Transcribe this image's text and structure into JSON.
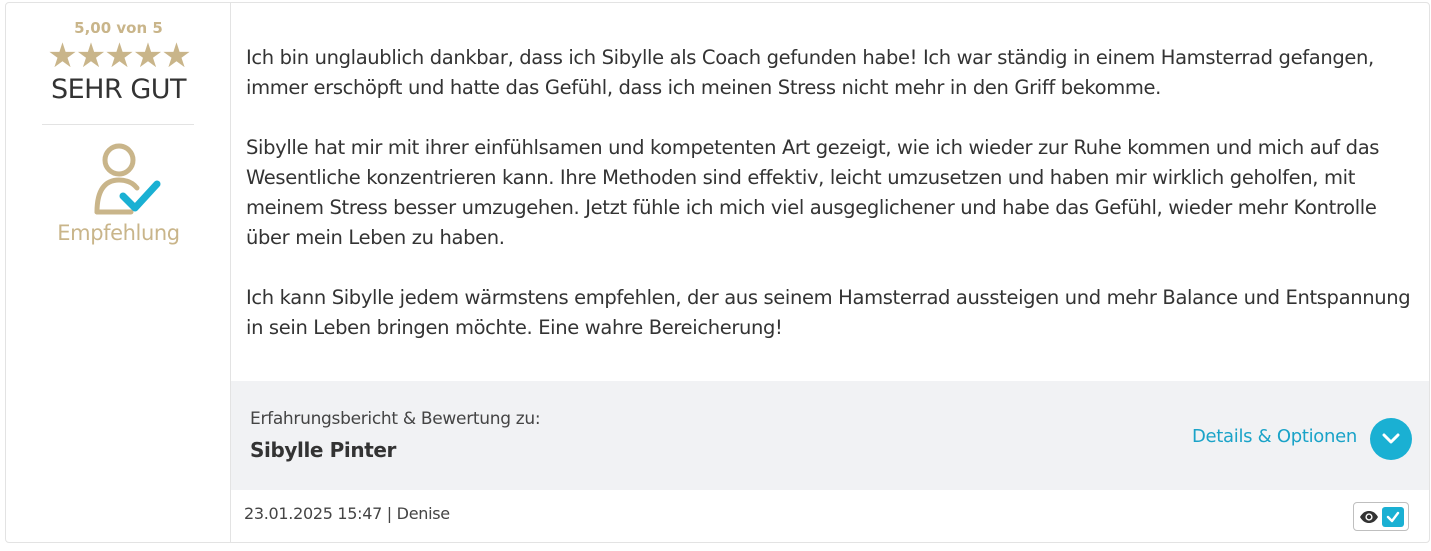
{
  "rating": {
    "score_text": "5,00 von 5",
    "stars": "★★★★★",
    "stars_count": 5,
    "label": "SEHR GUT",
    "color": "#c9b58a"
  },
  "recommendation": {
    "icon": "user-check-icon",
    "label": "Empfehlung"
  },
  "review": {
    "paragraphs": [
      "Ich bin unglaublich dankbar, dass ich Sibylle als Coach gefunden habe! Ich war ständig in einem Hamsterrad gefangen, immer erschöpft und hatte das Gefühl, dass ich meinen Stress nicht mehr in den Griff bekomme.",
      "Sibylle hat mir mit ihrer einfühlsamen und kompetenten Art gezeigt, wie ich wieder zur Ruhe kommen und mich auf das Wesentliche konzentrieren kann. Ihre Methoden sind effektiv, leicht umzusetzen und haben mir wirklich geholfen, mit meinem Stress besser umzugehen. Jetzt fühle ich mich viel ausgeglichener und habe das Gefühl, wieder mehr Kontrolle über mein Leben zu haben.",
      "Ich kann Sibylle jedem wärmstens empfehlen, der aus seinem Hamsterrad aussteigen und mehr Balance und Entspannung in sein Leben bringen möchte. Eine wahre Bereicherung!"
    ]
  },
  "footer": {
    "subtitle": "Erfahrungsbericht & Bewertung zu:",
    "name": "Sibylle Pinter",
    "details_label": "Details & Optionen",
    "accent": "#1ab0d3"
  },
  "meta": {
    "text": "23.01.2025 15:47 | Denise"
  },
  "badge": {
    "icons": [
      "eye-icon",
      "verified-check-icon"
    ]
  }
}
